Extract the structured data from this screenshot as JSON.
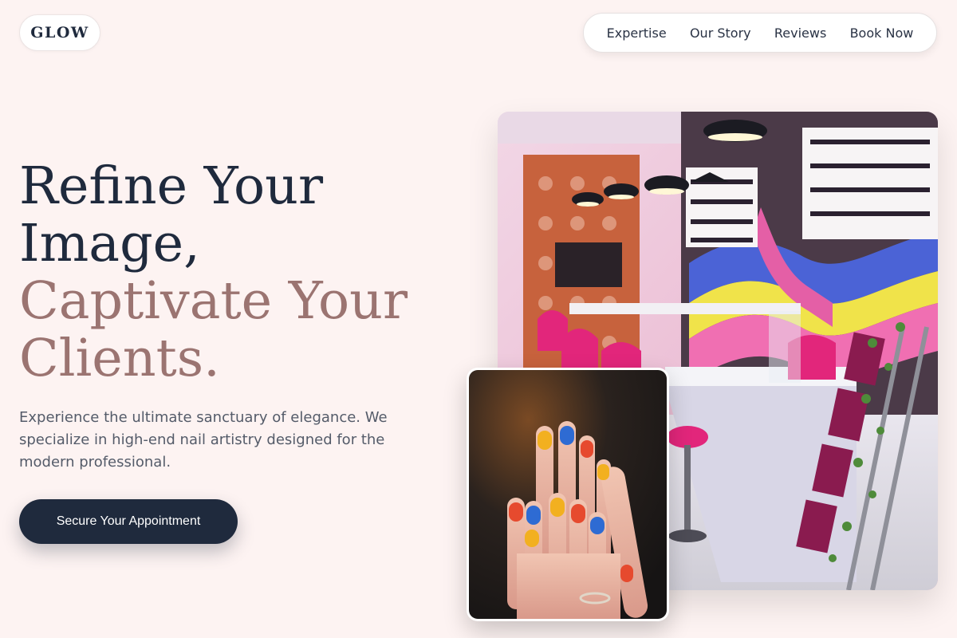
{
  "brand": {
    "logo": "GLOW"
  },
  "nav": {
    "items": [
      "Expertise",
      "Our Story",
      "Reviews",
      "Book Now"
    ]
  },
  "hero": {
    "headline_dark": [
      "Refine Your",
      "Image,"
    ],
    "headline_accent": [
      "Captivate Your",
      "Clients."
    ],
    "description": "Experience the ultimate sanctuary of elegance. We specialize in high-end nail artistry designed for the modern professional.",
    "cta_label": "Secure Your Appointment"
  },
  "colors": {
    "background": "#fdf3f2",
    "primary": "#1f2a3d",
    "accent": "#9b7471"
  },
  "images": {
    "salon_photo": "nail-salon-interior-photo",
    "hands_photo": "manicured-hands-photo"
  }
}
